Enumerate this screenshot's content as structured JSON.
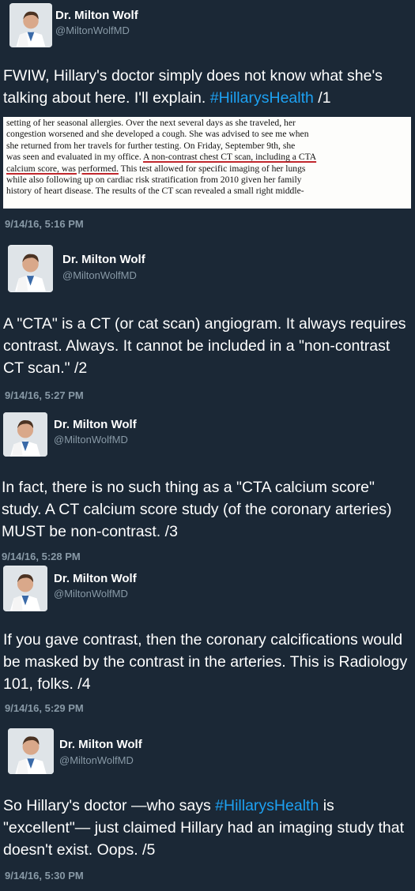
{
  "author": {
    "name": "Dr. Milton Wolf",
    "handle": "@MiltonWolfMD"
  },
  "colors": {
    "background": "#1b2836",
    "hashtag": "#1da1f2",
    "muted": "#8899a6",
    "underline": "#c0272d"
  },
  "tweets": [
    {
      "pre": "FWIW, Hillary's doctor simply does not know what she's talking about here. I'll explain. ",
      "hashtag": "#HillarysHealth",
      "post": " /1",
      "time": "9/14/16, 5:16 PM",
      "doc_lines": [
        "setting of her seasonal allergies.  Over the next several days as she traveled, her",
        "congestion worsened and she developed a cough.  She was advised to see me when",
        "she returned from her travels for further testing.  On Friday, September 9th, she",
        "was seen and evaluated in my office.  ",
        "A non-contrast chest CT scan, including a CTA",
        "calcium score, was performed.",
        "  This test allowed for specific imaging of her lungs",
        "while also following up on cardiac risk stratification from 2010 given her family",
        "history of heart disease.  The results of the CT scan revealed a small right middle-"
      ]
    },
    {
      "text": "A \"CTA\" is a CT (or cat scan) angiogram. It always requires contrast. Always. It cannot be included in a \"non-contrast CT scan.\" /2",
      "time": "9/14/16, 5:27 PM"
    },
    {
      "text": "In fact, there is no such thing as a \"CTA calcium score\" study. A CT calcium score study (of the coronary arteries) MUST be non-contrast. /3",
      "time": "9/14/16, 5:28 PM"
    },
    {
      "text": "If you gave contrast, then the coronary calcifications would be masked by the contrast in the arteries. This is Radiology 101, folks. /4",
      "time": "9/14/16, 5:29 PM"
    },
    {
      "pre": "So Hillary's doctor —who says ",
      "hashtag": "#HillarysHealth",
      "post": " is \"excellent\"— just claimed Hillary had an imaging study that doesn't exist. Oops. /5",
      "time": "9/14/16, 5:30 PM"
    }
  ]
}
